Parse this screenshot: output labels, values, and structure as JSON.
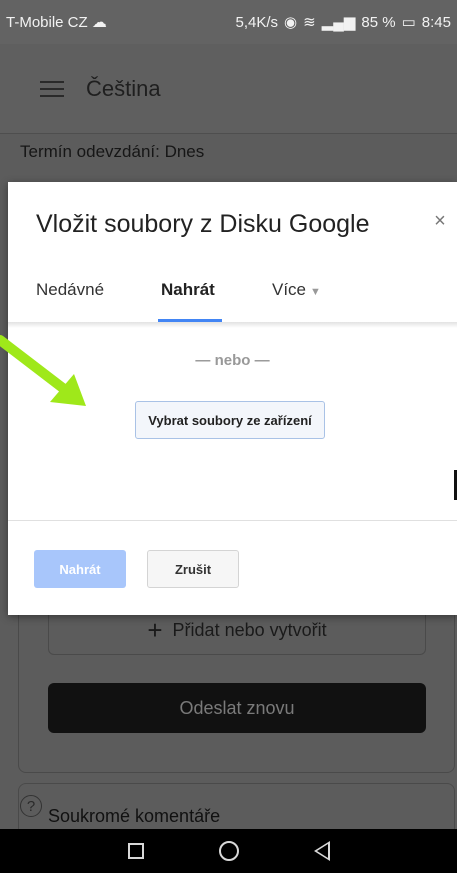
{
  "status_bar": {
    "carrier": "T-Mobile CZ",
    "speed": "5,4K/s",
    "battery": "85 %",
    "time": "8:45"
  },
  "app_bar": {
    "title": "Čeština"
  },
  "assignment": {
    "due": "Termín odevzdání: Dnes",
    "add_label": "Přidat nebo vytvořit",
    "resubmit_label": "Odeslat znovu",
    "private_comments": "Soukromé komentáře"
  },
  "dialog": {
    "title": "Vložit soubory z Disku Google",
    "close": "×",
    "tabs": [
      {
        "label": "Nedávné",
        "active": false
      },
      {
        "label": "Nahrát",
        "active": true
      },
      {
        "label": "Více",
        "active": false
      }
    ],
    "or_text": "— nebo —",
    "pick_button": "Vybrat soubory ze zařízení",
    "upload_button": "Nahrát",
    "cancel_button": "Zrušit"
  },
  "colors": {
    "accent": "#4285f4",
    "upload_disabled": "#a8c6fb",
    "annotation_arrow": "#9fe81a"
  },
  "icons": {
    "menu": "menu-icon",
    "close": "close-icon",
    "plus": "plus-icon",
    "help": "help-circle-icon"
  }
}
